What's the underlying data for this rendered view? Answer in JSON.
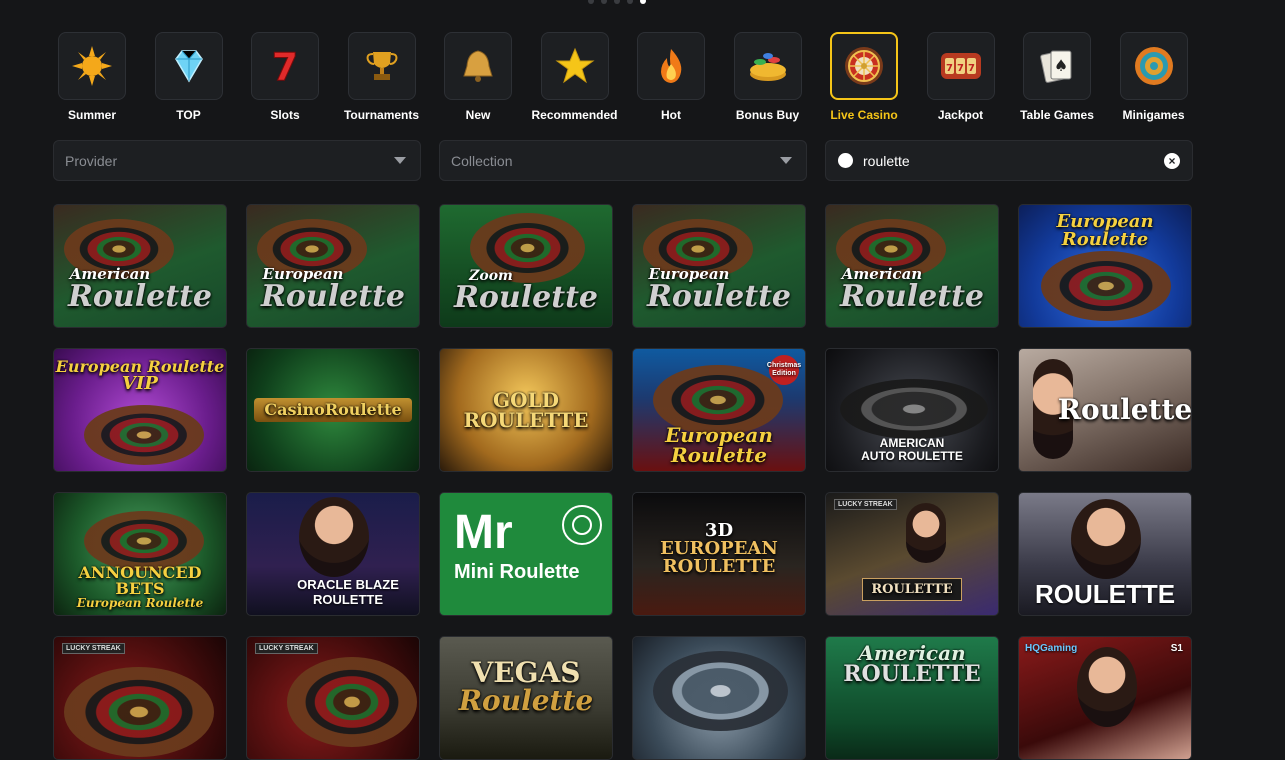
{
  "carousel": {
    "dots": 5,
    "active_index": 4
  },
  "categories": [
    {
      "label": "Summer",
      "icon": "sun-icon",
      "active": false
    },
    {
      "label": "TOP",
      "icon": "diamond-icon",
      "active": false
    },
    {
      "label": "Slots",
      "icon": "seven-icon",
      "active": false
    },
    {
      "label": "Tournaments",
      "icon": "trophy-icon",
      "active": false
    },
    {
      "label": "New",
      "icon": "bell-icon",
      "active": false
    },
    {
      "label": "Recommended",
      "icon": "star-icon",
      "active": false
    },
    {
      "label": "Hot",
      "icon": "fire-icon",
      "active": false
    },
    {
      "label": "Bonus Buy",
      "icon": "coins-icon",
      "active": false
    },
    {
      "label": "Live Casino",
      "icon": "roulette-wheel-icon",
      "active": true
    },
    {
      "label": "Jackpot",
      "icon": "slot-machine-icon",
      "active": false
    },
    {
      "label": "Table Games",
      "icon": "playing-cards-icon",
      "active": false
    },
    {
      "label": "Minigames",
      "icon": "target-icon",
      "active": false
    }
  ],
  "filters": {
    "provider_placeholder": "Provider",
    "collection_placeholder": "Collection",
    "search_value": "roulette"
  },
  "games": [
    {
      "title": "American",
      "subtitle": "Roulette"
    },
    {
      "title": "European",
      "subtitle": "Roulette"
    },
    {
      "title": "Zoom",
      "subtitle": "Roulette"
    },
    {
      "title": "European",
      "subtitle": "Roulette"
    },
    {
      "title": "American",
      "subtitle": "Roulette"
    },
    {
      "title": "European Roulette",
      "subtitle": ""
    },
    {
      "title": "European Roulette",
      "subtitle": "VIP"
    },
    {
      "title": "CasinoRoulette",
      "subtitle": ""
    },
    {
      "title": "GOLD",
      "subtitle": "ROULETTE"
    },
    {
      "title": "European Roulette",
      "subtitle": "Christmas Edition"
    },
    {
      "title": "AMERICAN",
      "subtitle": "AUTO ROULETTE"
    },
    {
      "title": "Roulette",
      "subtitle": ""
    },
    {
      "title": "ANNOUNCED BETS",
      "subtitle": "European Roulette"
    },
    {
      "title": "ORACLE BLAZE",
      "subtitle": "ROULETTE"
    },
    {
      "title": "Mr",
      "subtitle": "Mini Roulette"
    },
    {
      "title": "3D",
      "subtitle": "EUROPEAN ROULETTE"
    },
    {
      "title": "LUCKY STREAK",
      "subtitle": "ROULETTE"
    },
    {
      "title": "ROULETTE",
      "subtitle": ""
    },
    {
      "title": "LUCKY STREAK",
      "subtitle": ""
    },
    {
      "title": "LUCKY STREAK",
      "subtitle": ""
    },
    {
      "title": "VEGAS",
      "subtitle": "Roulette"
    },
    {
      "title": "",
      "subtitle": ""
    },
    {
      "title": "American",
      "subtitle": "ROULETTE"
    },
    {
      "title": "HQGaming",
      "subtitle": "S1"
    }
  ]
}
